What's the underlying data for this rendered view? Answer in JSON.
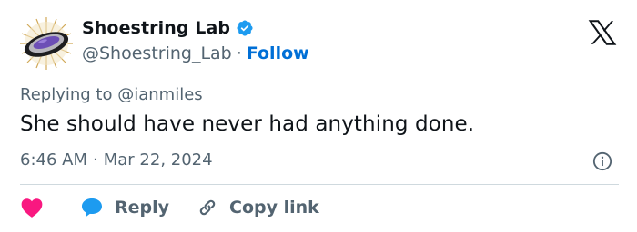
{
  "author": {
    "display_name": "Shoestring Lab",
    "handle": "@Shoestring_Lab",
    "separator": "·",
    "follow_label": "Follow",
    "verified_icon": "verified-badge-icon"
  },
  "reply_context": {
    "prefix": "Replying to",
    "mention": "@ianmiles"
  },
  "tweet": {
    "text": "She should have never had anything done.",
    "time": "6:46 AM",
    "separator": "·",
    "date": "Mar 22, 2024"
  },
  "actions": {
    "like_icon": "heart-icon",
    "reply_label": "Reply",
    "copy_link_label": "Copy link"
  },
  "colors": {
    "text": "#0f1419",
    "secondary": "#536471",
    "follow": "#006fd6",
    "verified": "#1d9bf0",
    "heart": "#f91880",
    "reply_bubble": "#1d9bf0",
    "divider": "#cfd9de"
  },
  "icons": [
    "avatar",
    "verified-badge-icon",
    "x-logo-icon",
    "info-icon",
    "heart-icon",
    "reply-bubble-icon",
    "link-icon"
  ]
}
